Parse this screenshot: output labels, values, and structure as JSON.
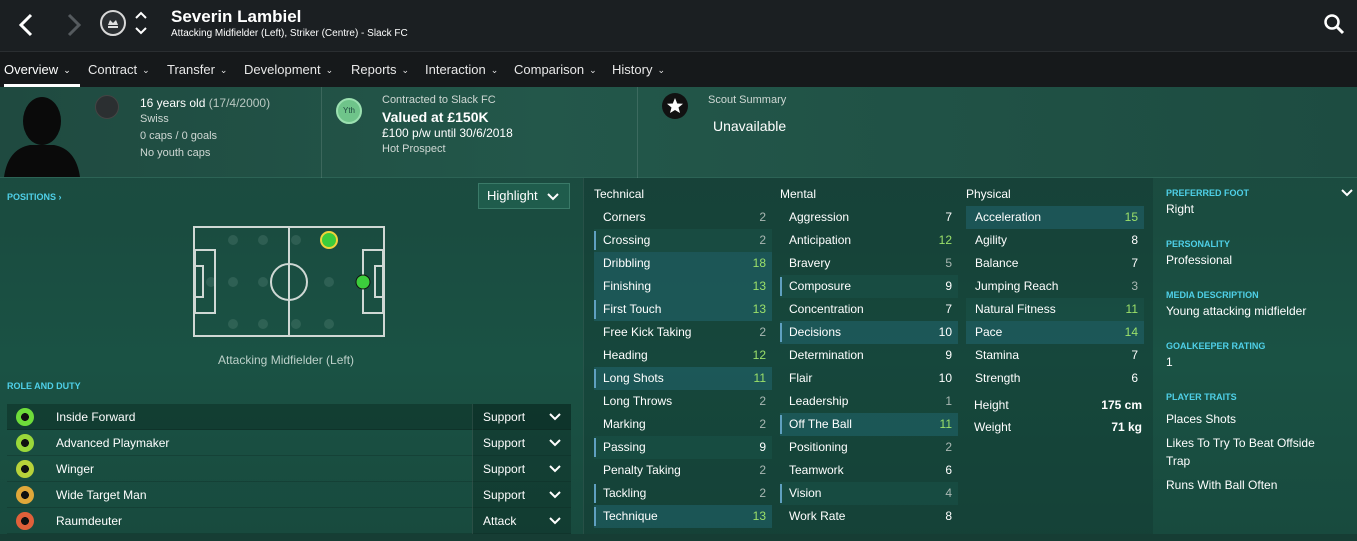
{
  "header": {
    "player_name": "Severin Lambiel",
    "player_sub": "Attacking Midfielder (Left), Striker (Centre) - Slack FC"
  },
  "tabs": [
    {
      "label": "Overview",
      "active": true
    },
    {
      "label": "Contract"
    },
    {
      "label": "Transfer"
    },
    {
      "label": "Development"
    },
    {
      "label": "Reports"
    },
    {
      "label": "Interaction"
    },
    {
      "label": "Comparison"
    },
    {
      "label": "History"
    }
  ],
  "profile": {
    "age": "16 years old",
    "dob": "(17/4/2000)",
    "nationality": "Swiss",
    "caps": "0 caps / 0 goals",
    "youth_caps": "No youth caps"
  },
  "contract": {
    "badge": "Yth",
    "contracted_to": "Contracted to Slack FC",
    "value": "Valued at £150K",
    "wage": "£100 p/w until 30/6/2018",
    "status": "Hot Prospect"
  },
  "scout": {
    "title": "Scout Summary",
    "value": "Unavailable"
  },
  "positions": {
    "title": "POSITIONS",
    "highlight_label": "Highlight",
    "position_label": "Attacking Midfielder (Left)"
  },
  "roles": {
    "title": "ROLE AND DUTY",
    "items": [
      {
        "name": "Inside Forward",
        "duty": "Support",
        "color": "#6edc3a"
      },
      {
        "name": "Advanced Playmaker",
        "duty": "Support",
        "color": "#9ad83a"
      },
      {
        "name": "Winger",
        "duty": "Support",
        "color": "#b8d23a"
      },
      {
        "name": "Wide Target Man",
        "duty": "Support",
        "color": "#e0a83a"
      },
      {
        "name": "Raumdeuter",
        "duty": "Attack",
        "color": "#e0603a"
      }
    ]
  },
  "attributes": {
    "technical_title": "Technical",
    "mental_title": "Mental",
    "physical_title": "Physical",
    "technical": [
      {
        "name": "Corners",
        "value": "2"
      },
      {
        "name": "Crossing",
        "value": "2"
      },
      {
        "name": "Dribbling",
        "value": "18"
      },
      {
        "name": "Finishing",
        "value": "13"
      },
      {
        "name": "First Touch",
        "value": "13"
      },
      {
        "name": "Free Kick Taking",
        "value": "2"
      },
      {
        "name": "Heading",
        "value": "12"
      },
      {
        "name": "Long Shots",
        "value": "11"
      },
      {
        "name": "Long Throws",
        "value": "2"
      },
      {
        "name": "Marking",
        "value": "2"
      },
      {
        "name": "Passing",
        "value": "9"
      },
      {
        "name": "Penalty Taking",
        "value": "2"
      },
      {
        "name": "Tackling",
        "value": "2"
      },
      {
        "name": "Technique",
        "value": "13"
      }
    ],
    "mental": [
      {
        "name": "Aggression",
        "value": "7"
      },
      {
        "name": "Anticipation",
        "value": "12"
      },
      {
        "name": "Bravery",
        "value": "5"
      },
      {
        "name": "Composure",
        "value": "9"
      },
      {
        "name": "Concentration",
        "value": "7"
      },
      {
        "name": "Decisions",
        "value": "10"
      },
      {
        "name": "Determination",
        "value": "9"
      },
      {
        "name": "Flair",
        "value": "10"
      },
      {
        "name": "Leadership",
        "value": "1"
      },
      {
        "name": "Off The Ball",
        "value": "11"
      },
      {
        "name": "Positioning",
        "value": "2"
      },
      {
        "name": "Teamwork",
        "value": "6"
      },
      {
        "name": "Vision",
        "value": "4"
      },
      {
        "name": "Work Rate",
        "value": "8"
      }
    ],
    "physical": [
      {
        "name": "Acceleration",
        "value": "15"
      },
      {
        "name": "Agility",
        "value": "8"
      },
      {
        "name": "Balance",
        "value": "7"
      },
      {
        "name": "Jumping Reach",
        "value": "3"
      },
      {
        "name": "Natural Fitness",
        "value": "11"
      },
      {
        "name": "Pace",
        "value": "14"
      },
      {
        "name": "Stamina",
        "value": "7"
      },
      {
        "name": "Strength",
        "value": "6"
      }
    ],
    "height_label": "Height",
    "height_value": "175 cm",
    "weight_label": "Weight",
    "weight_value": "71 kg"
  },
  "side": {
    "preferred_foot_label": "PREFERRED FOOT",
    "preferred_foot": "Right",
    "personality_label": "PERSONALITY",
    "personality": "Professional",
    "media_label": "MEDIA DESCRIPTION",
    "media": "Young attacking midfielder",
    "gk_label": "GOALKEEPER RATING",
    "gk": "1",
    "traits_label": "PLAYER TRAITS",
    "trait_1": "Places Shots",
    "trait_2a": "Likes To Try To Beat Offside",
    "trait_2b": "Trap",
    "trait_3": "Runs With Ball Often"
  }
}
